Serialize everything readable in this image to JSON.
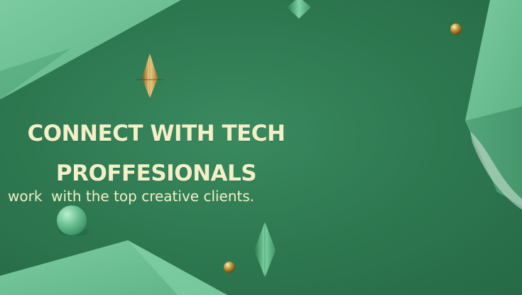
{
  "banner": {
    "headline": "CONNECT WITH TECH PROFFESIONALS",
    "tagline": "work  with the top creative clients."
  },
  "colors": {
    "background": "#2f7a52",
    "panel_light": "#6cbf93",
    "text": "#f3efc6",
    "gold": "#c99a3e"
  },
  "decorations": [
    "gold-diamond-icon",
    "green-diamond-icon",
    "gold-sphere-icon",
    "green-sphere-icon"
  ]
}
